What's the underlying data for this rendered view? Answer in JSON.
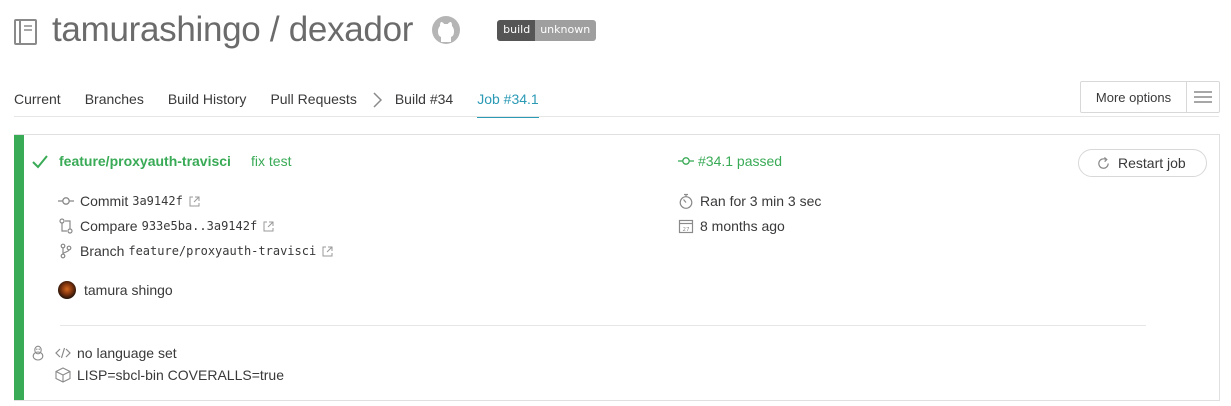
{
  "header": {
    "title": "tamurashingo / dexador",
    "badge_left": "build",
    "badge_right": "unknown"
  },
  "tabs": [
    {
      "label": "Current"
    },
    {
      "label": "Branches"
    },
    {
      "label": "Build History"
    },
    {
      "label": "Pull Requests"
    },
    {
      "label": "Build #34"
    },
    {
      "label": "Job #34.1"
    }
  ],
  "more_options": {
    "label": "More options"
  },
  "job": {
    "branch": "feature/proxyauth-travisci",
    "message": "fix test",
    "commit_label": "Commit",
    "commit_sha": "3a9142f",
    "compare_label": "Compare",
    "compare_range": "933e5ba..3a9142f",
    "branch_label": "Branch",
    "branch_value": "feature/proxyauth-travisci",
    "author": "tamura shingo",
    "status": "#34.1 passed",
    "duration": "Ran for 3 min 3 sec",
    "finished": "8 months ago",
    "restart_label": "Restart job",
    "language": "no language set",
    "env": "LISP=sbcl-bin COVERALLS=true"
  },
  "colors": {
    "passed": "#39aa56",
    "active_tab": "#2b9ab5"
  }
}
